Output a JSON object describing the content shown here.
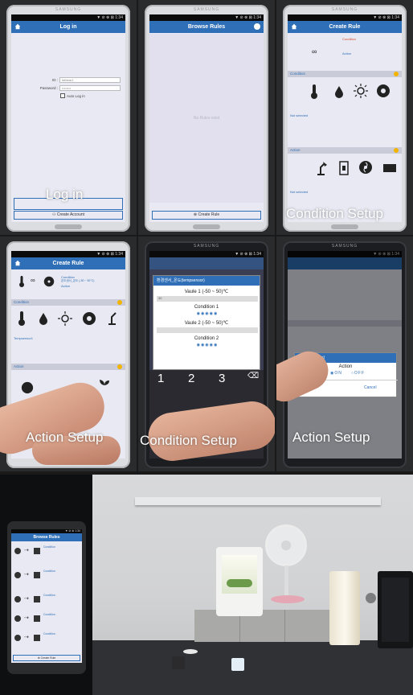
{
  "panels": {
    "login": {
      "brand": "SAMSUNG",
      "status": "▼ ⊘ ⊗ ⊠ 1:34",
      "title": "Log in",
      "id_label": "ID :",
      "id_value": "fatbear1",
      "password_label": "Password :",
      "password_value": "••••••••",
      "auto_login": "Auto Log in",
      "create_account": "Create Account",
      "caption": "Log in"
    },
    "browse_empty": {
      "brand": "SAMSUNG",
      "status": "▼ ⊘ ⊗ ⊠ 1:34",
      "title": "Browse Rules",
      "empty": "No Rules exist",
      "create_rule": "Create Rule"
    },
    "condition_setup": {
      "brand": "SAMSUNG",
      "status": "▼ ⊘ ⊗ ⊠ 1:34",
      "title": "Create Rule",
      "condition": "Condition",
      "action": "Action",
      "condition_header": "Condition",
      "action_header": "Action",
      "not_selected": "Not selected",
      "caption": "Condition Setup"
    },
    "action_setup": {
      "status": "▼ ⊘ ⊗ ⊠ 1:34",
      "title": "Create Rule",
      "condition_header": "Condition",
      "action_header": "Action",
      "condition_text": "Condition",
      "temp_text": "온도센서_온도 (-50 ~ 50°C)",
      "action_text": "Action",
      "selected": "Tempsensor1",
      "caption": "Action Setup"
    },
    "condition_dialog": {
      "brand": "SAMSUNG",
      "status": "▼ ⊘ ⊗ ⊠ 1:34",
      "dialog_title": "환경센서_온도(tempsensor)",
      "value1_label": "Vaule 1 (-50 ~ 50)℃",
      "value1": "30",
      "condition1": "Condition 1",
      "value2_label": "Vaule 2 (-50 ~ 50)℃",
      "condition2": "Condition 2",
      "keys": [
        "1",
        "2",
        "3"
      ],
      "caption": "Condition Setup"
    },
    "action_dialog": {
      "brand": "SAMSUNG",
      "status": "▼ ⊘ ⊗ ⊠ 1:34",
      "dialog_title": "선풍기(coolfan)",
      "action": "Action",
      "on": "ON",
      "off": "OFF",
      "cancel": "Cancel",
      "caption": "Action Setup"
    }
  },
  "photo": {
    "phone_title": "Browse Rules",
    "phone_status": "▼ ⊘ ⊗ 1:34",
    "create_rule": "Create Rule",
    "rule_text": "Condition"
  },
  "colors": {
    "accent": "#2f6fb7",
    "screen": "#e8e9f2",
    "badge": "#f2b400"
  }
}
